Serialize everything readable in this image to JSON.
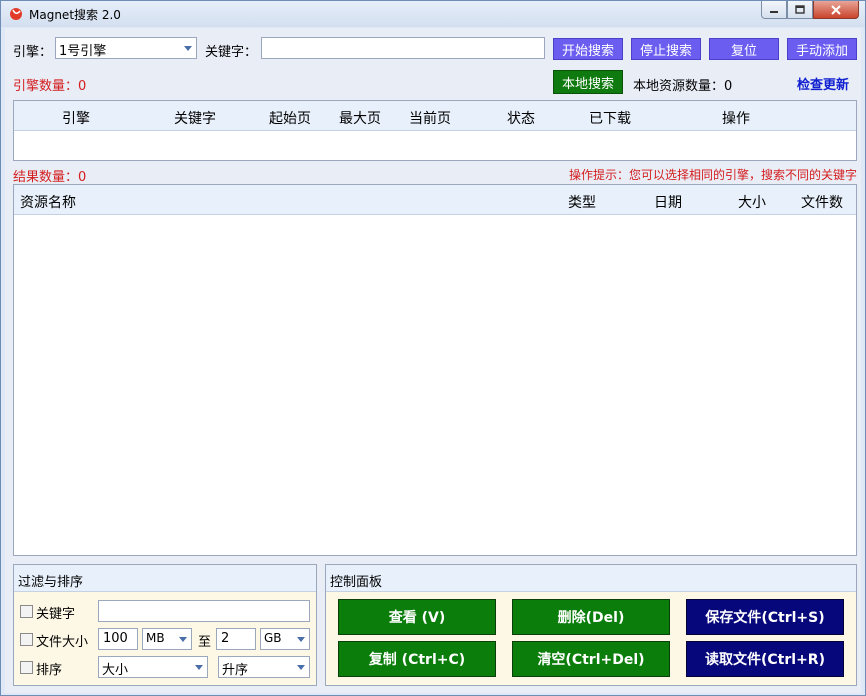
{
  "window": {
    "title": "Magnet搜索 2.0"
  },
  "top": {
    "engine_label": "引擎：",
    "engine_value": "1号引擎",
    "keyword_label": "关键字：",
    "keyword_value": "",
    "start_btn": "开始搜索",
    "stop_btn": "停止搜索",
    "reset_btn": "复位",
    "add_btn": "手动添加",
    "engine_count": "引擎数量：0",
    "local_search_btn": "本地搜索",
    "local_count": "本地资源数量：0",
    "check_update": "检查更新"
  },
  "engine_grid": {
    "columns": [
      "引擎",
      "关键字",
      "起始页",
      "最大页",
      "当前页",
      "状态",
      "已下载",
      "操作"
    ]
  },
  "result_bar": {
    "count": "结果数量：0",
    "tip": "操作提示：您可以选择相同的引擎，搜索不同的关键字"
  },
  "result_grid": {
    "columns": [
      "资源名称",
      "类型",
      "日期",
      "大小",
      "文件数"
    ]
  },
  "filter": {
    "title": "过滤与排序",
    "keyword_label": "关键字",
    "keyword_value": "",
    "size_label": "文件大小",
    "size_min": "100",
    "size_min_unit": "MB",
    "to_label": "至",
    "size_max": "2",
    "size_max_unit": "GB",
    "sort_label": "排序",
    "sort_field": "大小",
    "sort_order": "升序"
  },
  "control": {
    "title": "控制面板",
    "view_btn": "查看 (V)",
    "delete_btn": "删除(Del)",
    "save_btn": "保存文件(Ctrl+S)",
    "copy_btn": "复制 (Ctrl+C)",
    "clear_btn": "清空(Ctrl+Del)",
    "load_btn": "读取文件(Ctrl+R)"
  },
  "colors": {
    "purple_button": "#6a5df0",
    "green_button": "#0b7d0b",
    "navy_button": "#07077c",
    "red_text": "#d41d1d",
    "link_blue": "#1020d0"
  }
}
